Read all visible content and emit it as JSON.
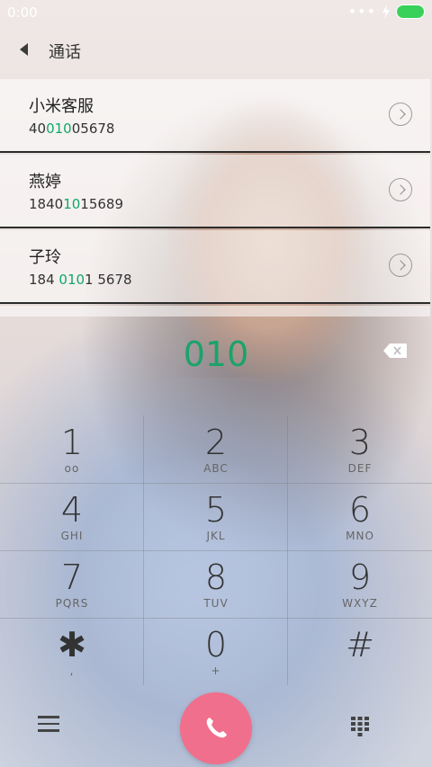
{
  "statusbar": {
    "time": "0:00",
    "dots": "•••",
    "battery_color": "#3ad15a"
  },
  "header": {
    "title": "通话"
  },
  "contacts": [
    {
      "name": "小米客服",
      "num_pre": "40",
      "num_hl": "010",
      "num_post": "05678"
    },
    {
      "name": "燕婷",
      "num_pre": "1840",
      "num_hl": "10",
      "num_post": "15689"
    },
    {
      "name": "子玲",
      "num_pre": "184 ",
      "num_hl": "010",
      "num_post": "1 5678"
    }
  ],
  "dialed": "010",
  "keys": [
    {
      "digit": "1",
      "letters": "ᴏᴏ"
    },
    {
      "digit": "2",
      "letters": "ABC"
    },
    {
      "digit": "3",
      "letters": "DEF"
    },
    {
      "digit": "4",
      "letters": "GHI"
    },
    {
      "digit": "5",
      "letters": "JKL"
    },
    {
      "digit": "6",
      "letters": "MNO"
    },
    {
      "digit": "7",
      "letters": "PQRS"
    },
    {
      "digit": "8",
      "letters": "TUV"
    },
    {
      "digit": "9",
      "letters": "WXYZ"
    },
    {
      "digit": "✱",
      "letters": ","
    },
    {
      "digit": "0",
      "letters": "+"
    },
    {
      "digit": "#",
      "letters": ""
    }
  ],
  "colors": {
    "accent": "#12a66a",
    "call": "#f06f8c"
  }
}
